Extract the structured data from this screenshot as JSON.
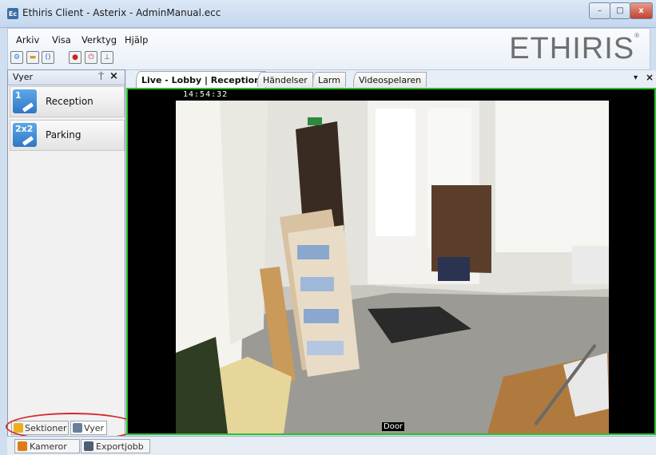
{
  "window": {
    "title": "Ethiris Client - Asterix - AdminManual.ecc",
    "app_icon_text": "Ec",
    "minimize": "–",
    "maximize": "□",
    "close": "x"
  },
  "menu": {
    "items": [
      "Arkiv",
      "Visa",
      "Verktyg",
      "Hjälp"
    ]
  },
  "toolbar": {
    "buttons": [
      {
        "icon": "settings-icon",
        "glyph": "⚙",
        "color": "#2a7fc4"
      },
      {
        "icon": "folder-icon",
        "glyph": "▬",
        "color": "#d99b1a"
      },
      {
        "icon": "brackets-icon",
        "glyph": "()",
        "color": "#2a5fa8"
      },
      {
        "icon": "record-icon",
        "glyph": "●",
        "color": "#d02020"
      },
      {
        "icon": "power-icon",
        "glyph": "⏻",
        "color": "#d02020"
      },
      {
        "icon": "export-icon",
        "glyph": "⊥",
        "color": "#555555"
      }
    ]
  },
  "brand": {
    "text": "ETHIRIS",
    "mark": "®"
  },
  "panel": {
    "title": "Vyer",
    "pin": "⍑",
    "close": "×",
    "views": [
      {
        "badge": "1",
        "label": "Reception"
      },
      {
        "badge": "2x2",
        "label": "Parking"
      }
    ],
    "section_tabs": [
      "Sektioner",
      "Vyer"
    ]
  },
  "bottom_tabs": [
    "Kameror",
    "Exportjobb"
  ],
  "content_tabs": [
    {
      "label": "Live - Lobby | Reception",
      "active": true
    },
    {
      "label": "Händelser",
      "active": false
    },
    {
      "label": "Larm",
      "active": false
    },
    {
      "label": "Videospelaren",
      "active": false
    }
  ],
  "content_tab_controls": {
    "menu": "▾",
    "close": "×"
  },
  "video": {
    "timestamp": "14:54:32",
    "camera_label": "Door",
    "border_color": "#2fc02f"
  }
}
